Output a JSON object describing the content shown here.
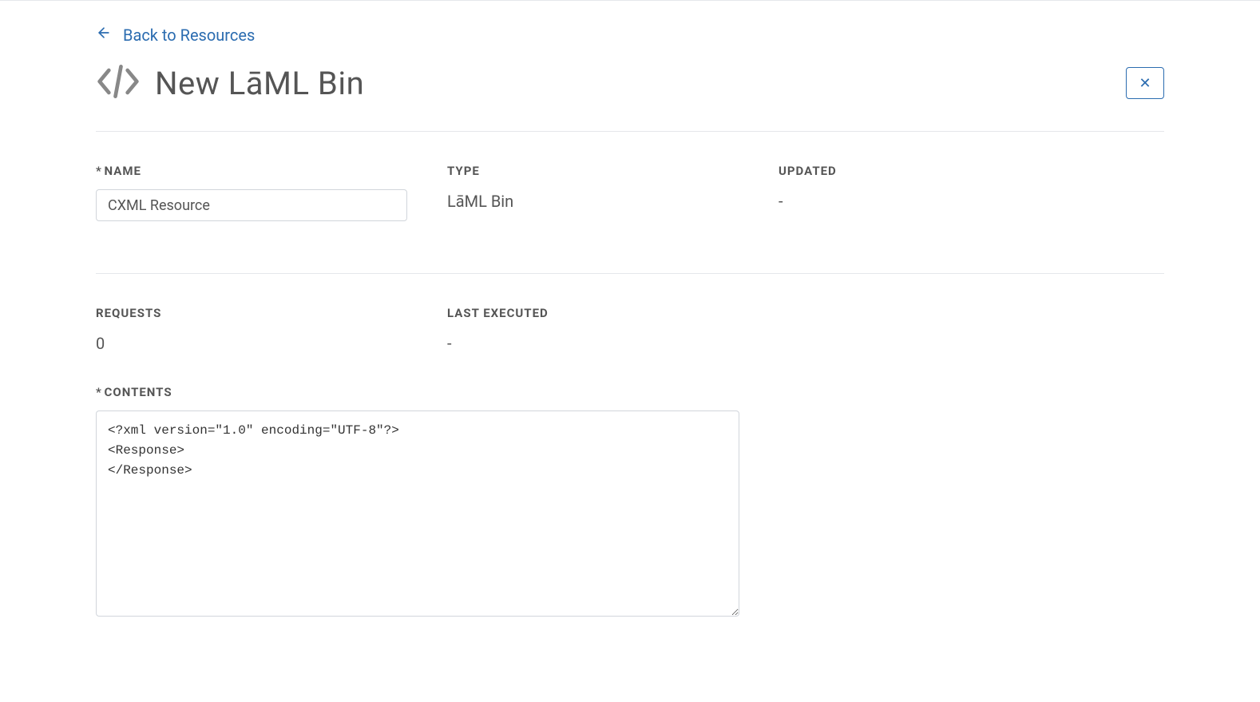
{
  "nav": {
    "back_label": "Back to Resources"
  },
  "header": {
    "title": "New LāML Bin",
    "close_symbol": "✕"
  },
  "fields": {
    "name": {
      "label": "Name",
      "value": "CXML Resource"
    },
    "type": {
      "label": "Type",
      "value": "LāML Bin"
    },
    "updated": {
      "label": "Updated",
      "value": "-"
    },
    "requests": {
      "label": "Requests",
      "value": "0"
    },
    "last_executed": {
      "label": "Last Executed",
      "value": "-"
    },
    "contents": {
      "label": "Contents",
      "value": "<?xml version=\"1.0\" encoding=\"UTF-8\"?>\n<Response>\n</Response>"
    }
  }
}
